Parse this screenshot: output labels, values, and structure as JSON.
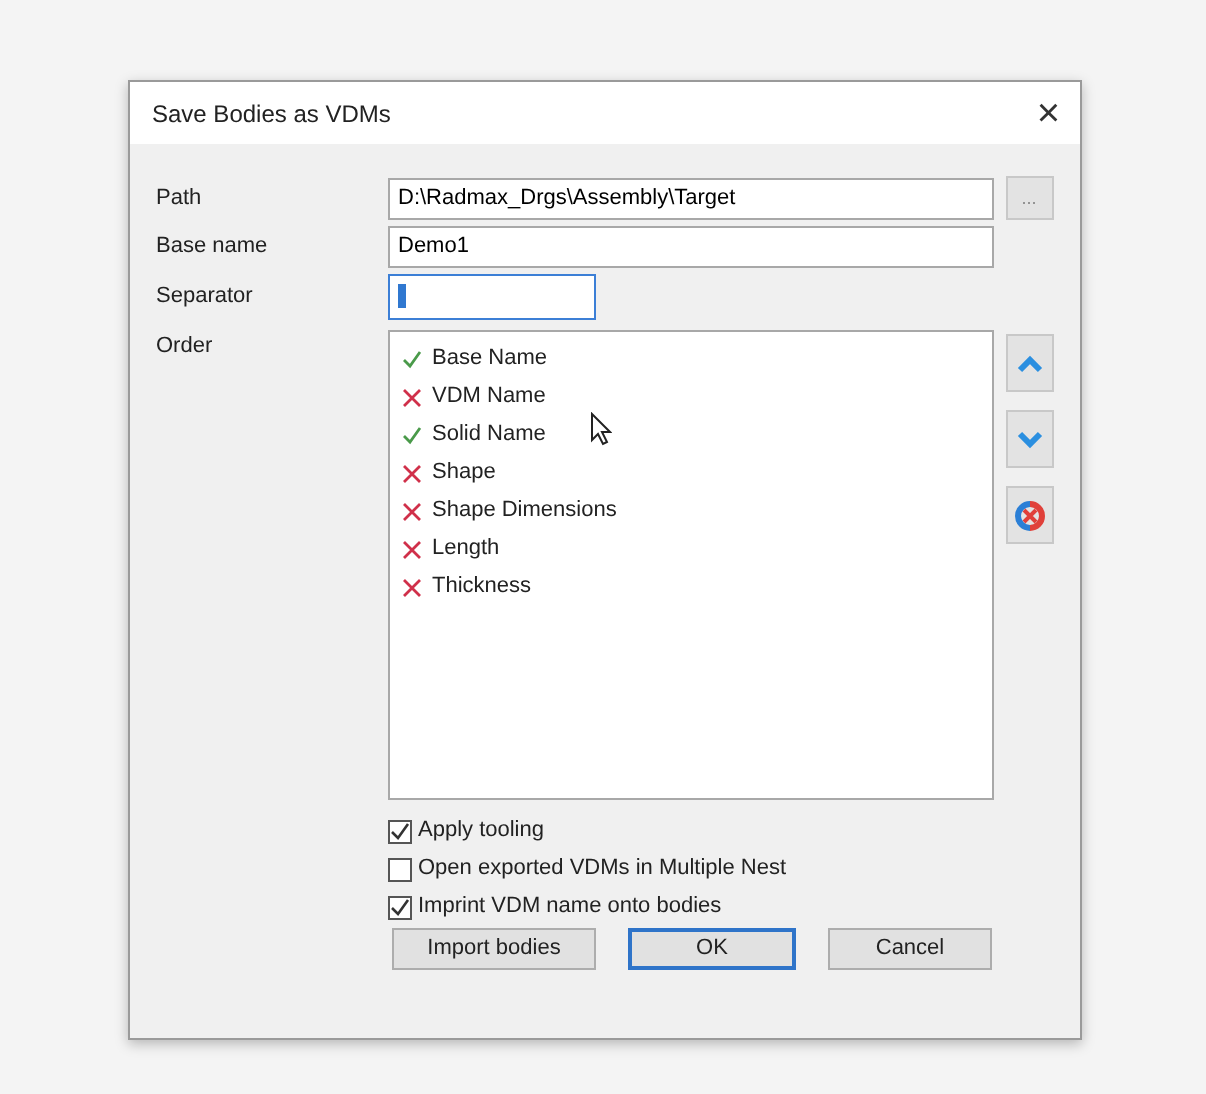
{
  "window": {
    "title": "Save Bodies as VDMs",
    "close": "×"
  },
  "fields": [
    {
      "label": "Path",
      "value": "D:\\Radmax_Drgs\\Assembly\\Target",
      "kind": "browse",
      "browse": "..."
    },
    {
      "label": "Base name",
      "value": "Demo1",
      "kind": "text"
    },
    {
      "label": "Separator",
      "kind": "short",
      "selected": true
    }
  ],
  "order": {
    "label": "Order",
    "items": [
      {
        "text": "Base Name",
        "checked": true
      },
      {
        "text": "VDM Name",
        "checked": false
      },
      {
        "text": "Solid Name",
        "checked": true
      },
      {
        "text": "Shape",
        "checked": false
      },
      {
        "text": "Shape Dimensions",
        "checked": false
      },
      {
        "text": "Length",
        "checked": false
      },
      {
        "text": "Thickness",
        "checked": false
      }
    ]
  },
  "options": [
    {
      "label": "Apply tooling",
      "checked": true
    },
    {
      "label": "Open exported VDMs in Multiple Nest",
      "checked": false
    },
    {
      "label": "Imprint VDM name onto bodies",
      "checked": true
    }
  ],
  "buttons": [
    {
      "label": "Import bodies",
      "default": false
    },
    {
      "label": "OK",
      "default": true
    },
    {
      "label": "Cancel",
      "default": false
    }
  ]
}
